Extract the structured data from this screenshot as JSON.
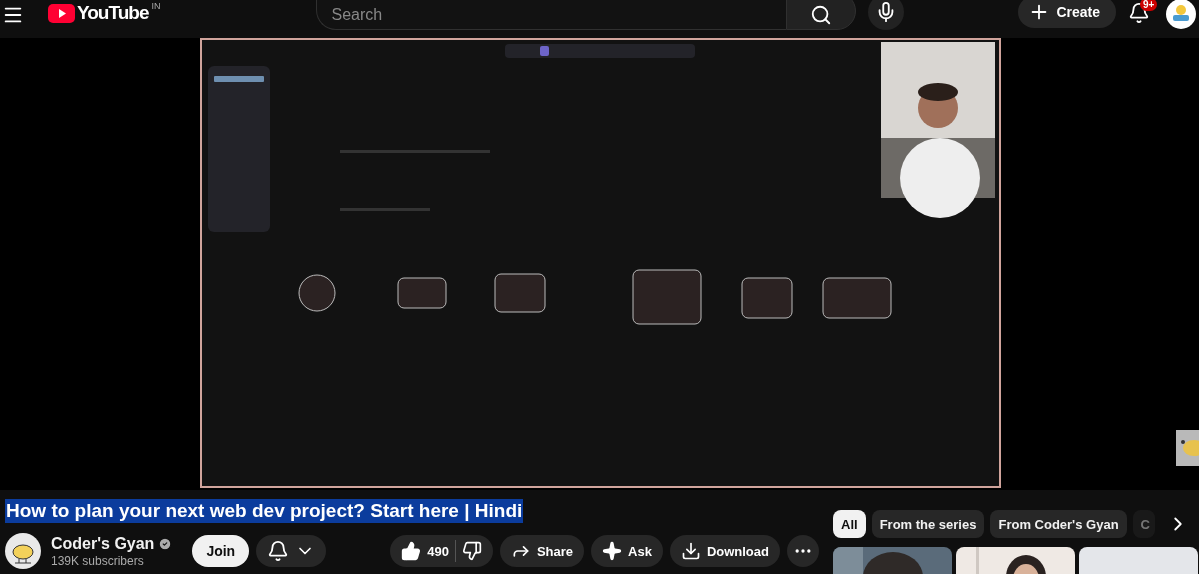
{
  "header": {
    "logo": "YouTube",
    "region": "IN",
    "search": {
      "placeholder": "Search"
    },
    "create": "Create",
    "notifications": "9+"
  },
  "title": {
    "text": "How to plan your next web dev project? Start here | Hindi",
    "highlighted": true
  },
  "channel": {
    "name": "Coder's Gyan",
    "verified": true,
    "subscribers": "139K subscribers",
    "join": "Join"
  },
  "likes": "490",
  "actions": [
    {
      "kind": "share",
      "label": "Share"
    },
    {
      "kind": "ask",
      "label": "Ask"
    },
    {
      "kind": "download",
      "label": "Download"
    }
  ],
  "chips": [
    {
      "label": "All",
      "selected": true
    },
    {
      "label": "From the series",
      "selected": false
    },
    {
      "label": "From Coder's Gyan",
      "selected": false
    },
    {
      "label": "C",
      "selected": false
    }
  ]
}
